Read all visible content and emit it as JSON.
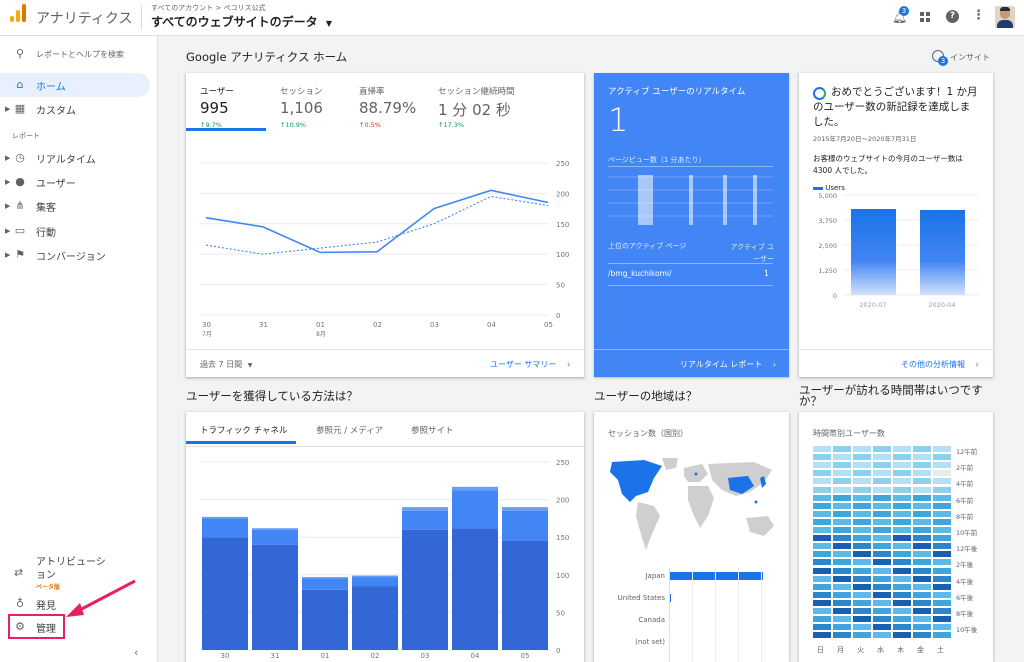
{
  "header": {
    "app_name": "アナリティクス",
    "breadcrumb": "すべてのアカウント > ペコリス公式",
    "view_selector": "すべてのウェブサイトのデータ",
    "notification_count": "3"
  },
  "sidebar": {
    "search_label": "レポートとヘルプを検索",
    "home": "ホーム",
    "custom": "カスタム",
    "section_reports": "レポート",
    "items": [
      "リアルタイム",
      "ユーザー",
      "集客",
      "行動",
      "コンバージョン"
    ],
    "attribution": "アトリビューション",
    "beta": "ベータ版",
    "discover": "発見",
    "admin": "管理"
  },
  "page_title": "Google アナリティクス ホーム",
  "insight": {
    "label": "インサイト",
    "count": "3"
  },
  "overview": {
    "metrics": [
      {
        "label": "ユーザー",
        "value": "995",
        "change": "↑9.7%"
      },
      {
        "label": "セッション",
        "value": "1,106",
        "change": "↑10.9%"
      },
      {
        "label": "直帰率",
        "value": "88.79%",
        "change": "↑0.5%"
      },
      {
        "label": "セッション継続時間",
        "value": "1 分 02 秒",
        "change": "↑17.3%"
      }
    ],
    "date_range": "過去 7 日間",
    "link": "ユーザー サマリー",
    "x_ticks": [
      "30",
      "31",
      "01",
      "02",
      "03",
      "04",
      "05"
    ],
    "month_labels": [
      "7月",
      "8月"
    ],
    "y_ticks": [
      "250",
      "200",
      "150",
      "100",
      "50",
      "0"
    ]
  },
  "realtime": {
    "title": "アクティブ ユーザーのリアルタイム",
    "value": "1",
    "pageviews_label": "ページビュー数（1 分あたり）",
    "col_page": "上位のアクティブ ページ",
    "col_users": "アクティブ ユーザー",
    "page": "/bmg_kuchikomi/",
    "page_users": "1",
    "link": "リアルタイム レポート"
  },
  "milestone": {
    "title": "おめでとうございます！1 か月のユーザー数の新記録を達成しました。",
    "date": "2015年7月20日～2020年7月31日",
    "text": "お客様のウェブサイトの今月のユーザー数は 4300 人でした。",
    "legend": "Users",
    "y_ticks": [
      "5,000",
      "3,750",
      "2,500",
      "1,250",
      "0"
    ],
    "x_ticks": [
      "2020-07",
      "2020-04"
    ],
    "link": "その他の分析情報"
  },
  "acquisition": {
    "heading": "ユーザーを獲得している方法は？",
    "tabs": [
      "トラフィック チャネル",
      "参照元 / メディア",
      "参照サイト"
    ],
    "y_ticks": [
      "250",
      "200",
      "150",
      "100",
      "50",
      "0"
    ],
    "x_ticks": [
      "30",
      "31",
      "01",
      "02",
      "03",
      "04",
      "05"
    ]
  },
  "geo": {
    "heading": "ユーザーの地域は？",
    "subtitle": "セッション数（国別）",
    "countries": [
      "Japan",
      "United States",
      "Canada",
      "(not set)"
    ]
  },
  "time_heatmap": {
    "heading": "ユーザーが訪れる時間帯はいつですか？",
    "subtitle": "時間帯別ユーザー数",
    "hours": [
      "12午前",
      "2午前",
      "4午前",
      "6午前",
      "8午前",
      "10午前",
      "12午後",
      "2午後",
      "4午後",
      "6午後",
      "8午後",
      "10午後"
    ],
    "days": [
      "日",
      "月",
      "火",
      "水",
      "木",
      "金",
      "土"
    ]
  },
  "chart_data": [
    {
      "type": "line",
      "categories": [
        "30",
        "31",
        "01",
        "02",
        "03",
        "04",
        "05"
      ],
      "ylim": [
        0,
        250
      ],
      "series": [
        {
          "values": [
            160,
            145,
            103,
            104,
            175,
            205,
            185
          ]
        },
        {
          "values": [
            115,
            100,
            110,
            120,
            150,
            195,
            180
          ]
        }
      ]
    },
    {
      "type": "bar",
      "categories": [
        "2020-07",
        "2020-04"
      ],
      "series": [
        {
          "name": "Users",
          "values": [
            4300,
            4250
          ]
        }
      ],
      "ylim": [
        0,
        5000
      ]
    },
    {
      "type": "bar",
      "categories": [
        "30",
        "31",
        "01",
        "02",
        "03",
        "04",
        "05"
      ],
      "ylim": [
        0,
        250
      ],
      "series": [
        {
          "values": [
            150,
            140,
            80,
            85,
            160,
            162,
            145
          ]
        },
        {
          "values": [
            25,
            20,
            15,
            12,
            25,
            50,
            40
          ]
        },
        {
          "values": [
            2,
            2,
            2,
            2,
            5,
            5,
            5
          ]
        }
      ]
    }
  ]
}
